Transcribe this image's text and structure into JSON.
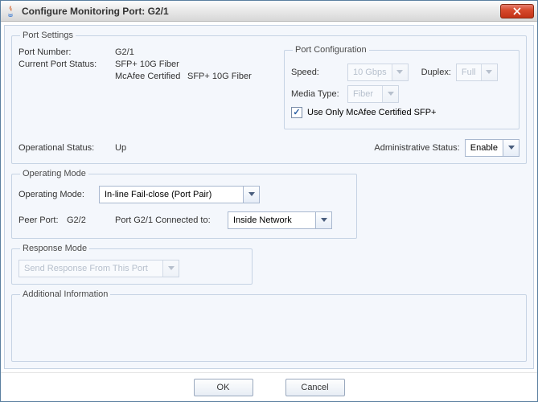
{
  "window": {
    "title": "Configure Monitoring Port: G2/1"
  },
  "portSettings": {
    "legend": "Port Settings",
    "portNumberLabel": "Port Number:",
    "portNumber": "G2/1",
    "currentStatusLabel": "Current Port Status:",
    "currentStatus": "SFP+ 10G Fiber",
    "certifiedLabel": "McAfee Certified",
    "certifiedValue": "SFP+ 10G Fiber",
    "opStatusLabel": "Operational Status:",
    "opStatus": "Up",
    "adminStatusLabel": "Administrative Status:",
    "adminStatus": "Enable"
  },
  "portConfig": {
    "legend": "Port Configuration",
    "speedLabel": "Speed:",
    "speed": "10 Gbps",
    "duplexLabel": "Duplex:",
    "duplex": "Full",
    "mediaTypeLabel": "Media Type:",
    "mediaType": "Fiber",
    "useOnlyCertifiedLabel": "Use Only McAfee Certified SFP+",
    "useOnlyCertified": true
  },
  "operatingMode": {
    "legend": "Operating Mode",
    "modeLabel": "Operating Mode:",
    "mode": "In-line Fail-close (Port Pair)",
    "peerPortLabel": "Peer Port:",
    "peerPort": "G2/2",
    "connectedToLabel": "Port G2/1 Connected to:",
    "connectedTo": "Inside Network"
  },
  "responseMode": {
    "legend": "Response Mode",
    "option": "Send Response From This Port"
  },
  "additional": {
    "legend": "Additional Information"
  },
  "buttons": {
    "ok": "OK",
    "cancel": "Cancel"
  }
}
